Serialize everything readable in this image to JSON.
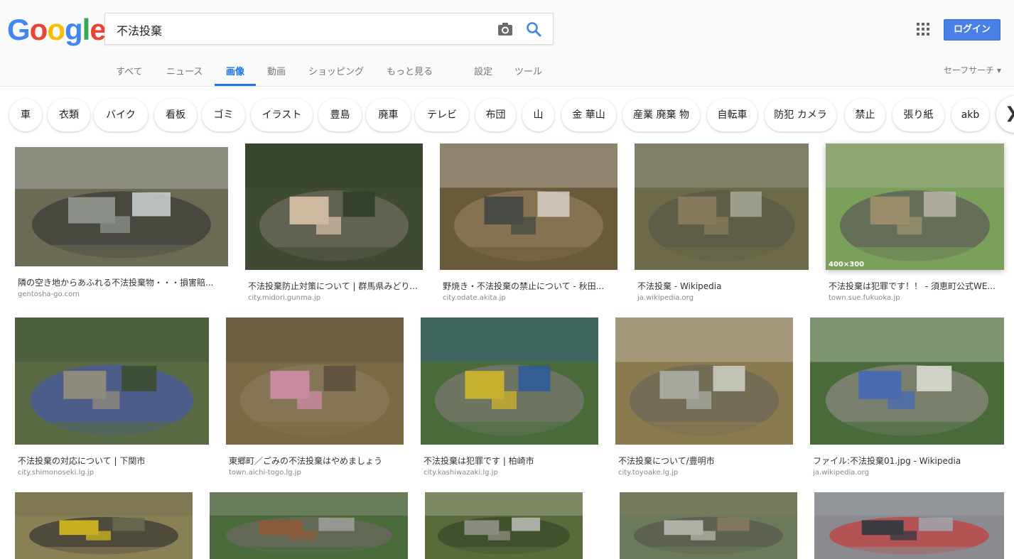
{
  "logo": {
    "letters": [
      "G",
      "o",
      "o",
      "g",
      "l",
      "e"
    ],
    "colors": [
      "#4285F4",
      "#EA4335",
      "#FBBC05",
      "#4285F4",
      "#34A853",
      "#EA4335"
    ]
  },
  "search": {
    "query": "不法投棄"
  },
  "header": {
    "login_label": "ログイン"
  },
  "tabs": [
    "すべて",
    "ニュース",
    "画像",
    "動画",
    "ショッピング",
    "もっと見る",
    "設定",
    "ツール"
  ],
  "active_tab": "画像",
  "safesearch_label": "セーフサーチ ▾",
  "chips": [
    "車",
    "衣類",
    "バイク",
    "看板",
    "ゴミ",
    "イラスト",
    "豊島",
    "廃車",
    "テレビ",
    "布団",
    "山",
    "金 華山",
    "産業 廃棄 物",
    "自転車",
    "防犯 カメラ",
    "禁止",
    "張り紙",
    "akb"
  ],
  "results": [
    {
      "title": "隣の空き地からあふれる不法投棄物・・・損害賠...",
      "domain": "gentosha-go.com",
      "palette": [
        "#6b6a55",
        "#8a8f88",
        "#3c3d3a",
        "#cfd2d4"
      ]
    },
    {
      "title": "不法投棄防止対策について | 群馬県みどり...",
      "domain": "city.midori.gunma.jp",
      "palette": [
        "#3f4a33",
        "#cdb8a0",
        "#6e6a60",
        "#2e3b27"
      ]
    },
    {
      "title": "野焼き・不法投棄の禁止について - 秋田...",
      "domain": "city.odate.akita.jp",
      "palette": [
        "#6a5a3c",
        "#4b4b45",
        "#8e7b58",
        "#d5d2c8"
      ]
    },
    {
      "title": "不法投棄 - Wikipedia",
      "domain": "ja.wikipedia.org",
      "palette": [
        "#6d6a4a",
        "#857a5b",
        "#5a5a48",
        "#a8a89a"
      ]
    },
    {
      "title": "不法投棄は犯罪です！！ - 須恵町公式WE...",
      "domain": "town.sue.fukuoka.jp",
      "palette": [
        "#7aa05a",
        "#9a8e6a",
        "#5d5d58",
        "#b8b4a8"
      ],
      "dim": "400×300"
    },
    {
      "title": "不法投棄の対応について | 下関市",
      "domain": "city.shimonoseki.lg.jp",
      "palette": [
        "#5a6a44",
        "#8e8a7c",
        "#4a5aa0",
        "#3a4a2a"
      ]
    },
    {
      "title": "東郷町／ごみの不法投棄はやめましょう",
      "domain": "town.aichi-togo.lg.jp",
      "palette": [
        "#7a6a45",
        "#c88aa0",
        "#8a7a5a",
        "#5a5040"
      ]
    },
    {
      "title": "不法投棄は犯罪です | 柏崎市",
      "domain": "city.kashiwazaki.lg.jp",
      "palette": [
        "#4a6a3a",
        "#c8b030",
        "#7a7a70",
        "#2a5a9a"
      ]
    },
    {
      "title": "不法投棄について/豊明市",
      "domain": "city.toyoake.lg.jp",
      "palette": [
        "#8a7a50",
        "#a8a8a0",
        "#6a6a55",
        "#d0d0c8"
      ]
    },
    {
      "title": "ファイル:不法投棄01.jpg - Wikipedia",
      "domain": "ja.wikipedia.org",
      "palette": [
        "#4a6a3a",
        "#4a6ab0",
        "#8a8a80",
        "#e0e0d8"
      ]
    },
    {
      "title": "",
      "domain": "",
      "palette": [
        "#8a8055",
        "#c8b020",
        "#3a3a35",
        "#6a6a50"
      ]
    },
    {
      "title": "",
      "domain": "",
      "palette": [
        "#4a6a3a",
        "#8a5a3a",
        "#6a6a60",
        "#a0a098"
      ]
    },
    {
      "title": "",
      "domain": "",
      "palette": [
        "#5a6a3a",
        "#8a8a80",
        "#3a4a2a",
        "#c0c0b8"
      ]
    },
    {
      "title": "",
      "domain": "",
      "palette": [
        "#6a7a5a",
        "#b0b0a8",
        "#5a5a50",
        "#8a7a60"
      ]
    },
    {
      "title": "",
      "domain": "",
      "palette": [
        "#8a8a90",
        "#3a3a40",
        "#c04040",
        "#a0a8b0"
      ]
    }
  ]
}
